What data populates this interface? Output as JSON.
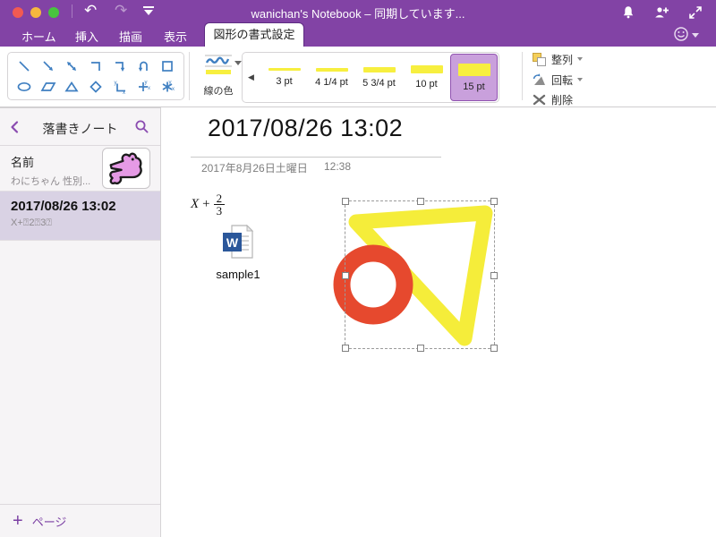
{
  "colors": {
    "titlebar_purple": "#8243a5",
    "accent_purple": "#7b3fa3",
    "tab_active_border": "#5e2c82",
    "gallery_selected_fill": "#c9a0dc",
    "gallery_selected_border": "#9154b0",
    "selected_page_bg": "#d9d2e4",
    "shape_icon_blue": "#3f7fc1",
    "drawing_yellow": "#f5ed3a",
    "drawing_red": "#e6492e",
    "word_blue": "#2b579a",
    "thumbnail_pink": "#e59ae5"
  },
  "titlebar": {
    "title": "wanichan's Notebook – 同期しています...",
    "icons": [
      "undo-icon",
      "redo-icon",
      "toolbar-collapse-icon",
      "bell-icon",
      "add-people-icon",
      "fullscreen-icon",
      "smiley-feedback-icon"
    ],
    "undo_glyph": "↶",
    "redo_glyph": "↷"
  },
  "tabs": {
    "items": [
      {
        "label": "ホーム",
        "active": false
      },
      {
        "label": "挿入",
        "active": false
      },
      {
        "label": "描画",
        "active": false
      },
      {
        "label": "表示",
        "active": false
      },
      {
        "label": "図形の書式設定",
        "active": true
      }
    ]
  },
  "ribbon": {
    "shapes": {
      "icons": [
        "line",
        "arrow",
        "double-arrow",
        "elbow-connector",
        "elbow-arrow",
        "u-turn-arrow",
        "rectangle",
        "ellipse",
        "parallelogram",
        "triangle",
        "diamond",
        "xy-axis",
        "cross-axis",
        "star-axis"
      ]
    },
    "line_color": {
      "label": "線の色"
    },
    "thickness": {
      "nav_prev_glyph": "◀",
      "options": [
        {
          "label": "3 pt",
          "selected": false
        },
        {
          "label": "4 1/4 pt",
          "selected": false
        },
        {
          "label": "5 3/4 pt",
          "selected": false
        },
        {
          "label": "10 pt",
          "selected": false
        },
        {
          "label": "15 pt",
          "selected": true
        }
      ]
    },
    "arrange_label": "整列",
    "rotate_label": "回転",
    "delete_label": "削除"
  },
  "sidebar": {
    "notebook_title": "落書きノート",
    "pages": [
      {
        "title": "名前",
        "subtitle": "わにちゃん 性別...",
        "selected": false
      },
      {
        "title": "2017/08/26 13:02",
        "subtitle": "X+⍰2⍰3⍰",
        "selected": true
      }
    ],
    "add_page_plus": "+",
    "add_page_label": "ページ"
  },
  "page": {
    "title": "2017/08/26 13:02",
    "date": "2017年8月26日土曜日",
    "time": "12:38",
    "equation": {
      "variable": "X",
      "operator": "+",
      "numerator": "2",
      "denominator": "3"
    },
    "attachment": {
      "name": "sample1",
      "type": "word-document",
      "icon_letter": "W"
    },
    "drawing": {
      "selected": true,
      "shapes": [
        {
          "type": "triangle-outline",
          "color": "#f5ed3a",
          "stroke": "15 pt"
        },
        {
          "type": "circle-outline",
          "color": "#e6492e",
          "stroke": "15 pt"
        }
      ]
    }
  }
}
